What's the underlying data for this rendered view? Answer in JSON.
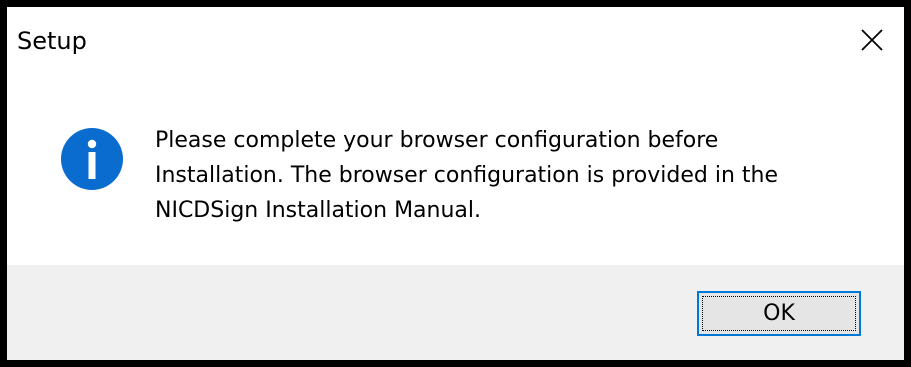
{
  "window": {
    "title": "Setup"
  },
  "dialog": {
    "icon": "info-icon",
    "message_lines": [
      "Please complete your browser configuration before",
      "Installation. The browser configuration is provided in the",
      "NICDSign Installation Manual."
    ],
    "ok_label": "OK"
  },
  "colors": {
    "accent": "#0078d7",
    "footer_bg": "#f0f0f0",
    "button_bg": "#e5e5e5"
  }
}
